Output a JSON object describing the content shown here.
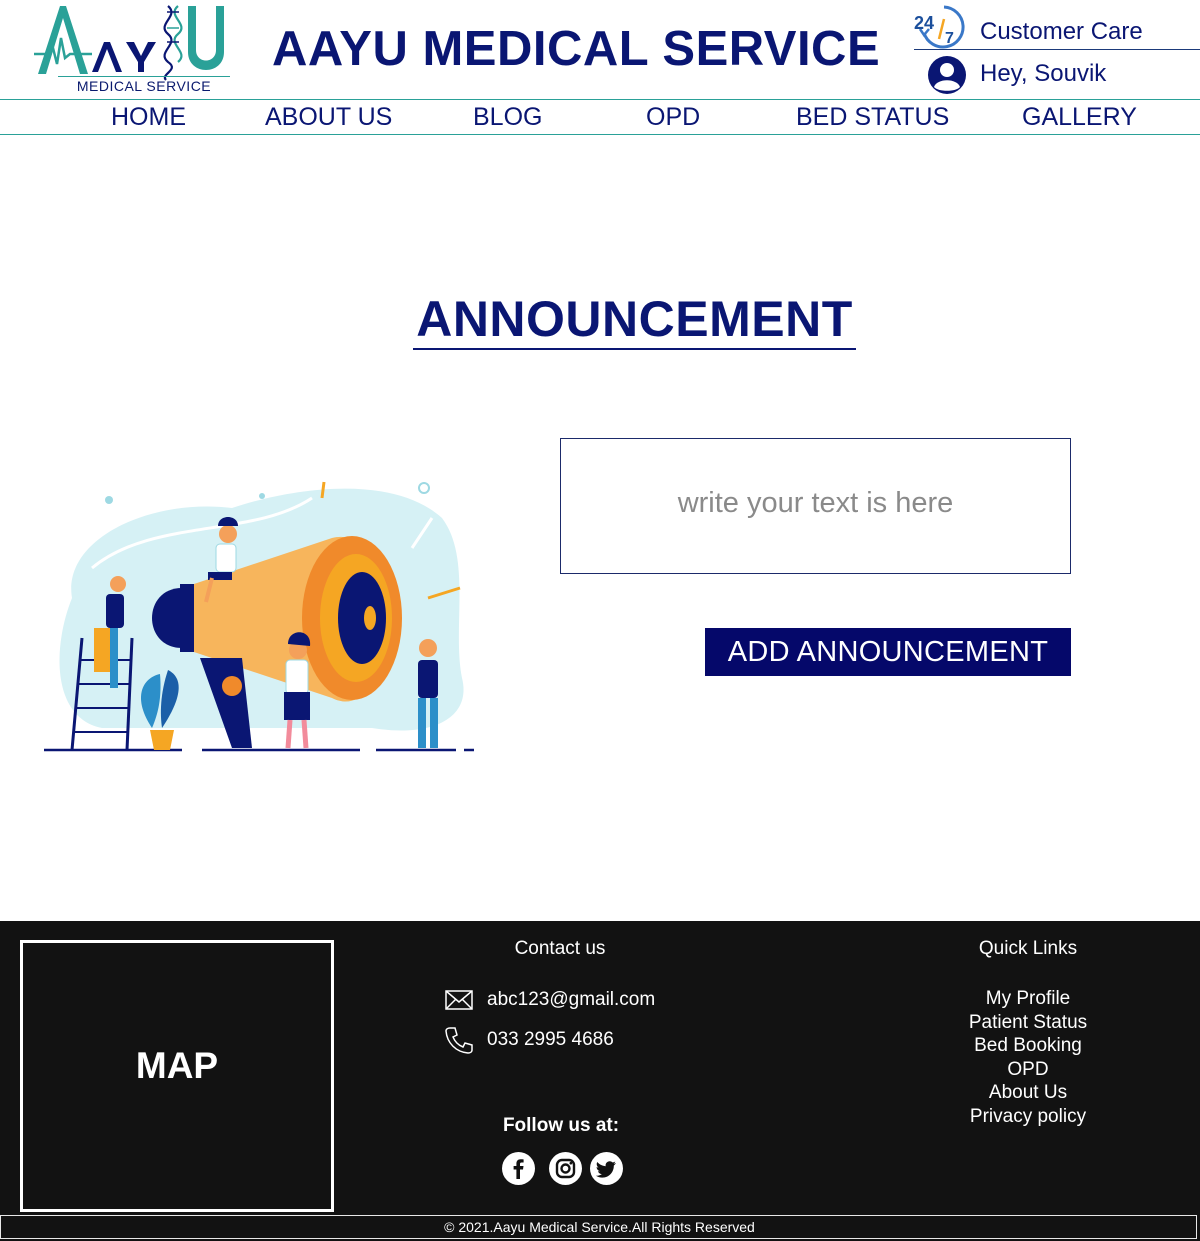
{
  "header": {
    "logo_subtitle": "MEDICAL SERVICE",
    "site_title": "AAYU MEDICAL SERVICE",
    "customer_care_badge": "24/7",
    "customer_care_label": "Customer Care",
    "greeting": "Hey, Souvik"
  },
  "nav": {
    "items": [
      "HOME",
      "ABOUT US",
      "BLOG",
      "OPD",
      "BED STATUS",
      "GALLERY"
    ]
  },
  "main": {
    "page_title": "ANNOUNCEMENT",
    "text_placeholder": "write your text is here",
    "add_button_label": "ADD ANNOUNCEMENT",
    "illustration_icon": "megaphone-illustration"
  },
  "footer": {
    "map_label": "MAP",
    "contact_title": "Contact us",
    "email": "abc123@gmail.com",
    "phone": "033 2995 4686",
    "follow_title": "Follow us at:",
    "social_icons": [
      "facebook-icon",
      "instagram-icon",
      "twitter-icon"
    ],
    "quick_links_title": "Quick Links",
    "quick_links": [
      "My Profile",
      "Patient Status",
      "Bed Booking",
      "OPD",
      "About Us",
      "Privacy policy"
    ],
    "copyright": "© 2021.Aayu Medical Service.All Rights Reserved"
  },
  "colors": {
    "primary_navy": "#0a1673",
    "button_navy": "#05086a",
    "teal_accent": "#2aa198",
    "footer_bg": "#121212",
    "illustration_orange": "#f5a623"
  }
}
